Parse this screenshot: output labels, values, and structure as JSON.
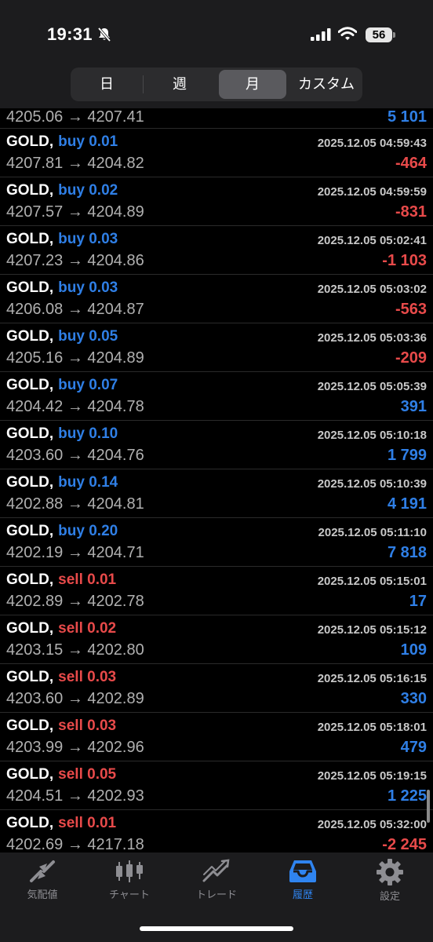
{
  "status_bar": {
    "time": "19:31",
    "battery": "56"
  },
  "period_tabs": [
    {
      "label": "日",
      "active": false
    },
    {
      "label": "週",
      "active": false
    },
    {
      "label": "月",
      "active": true
    },
    {
      "label": "カスタム",
      "active": false
    }
  ],
  "first_row": {
    "prices": "4205.06 → 4207.41",
    "profit": "5 101"
  },
  "deals": [
    {
      "symbol": "GOLD,",
      "side": "buy 0.01",
      "time": "2025.12.05 04:59:43",
      "prices": "4207.81 → 4204.82",
      "profit": "-464"
    },
    {
      "symbol": "GOLD,",
      "side": "buy 0.02",
      "time": "2025.12.05 04:59:59",
      "prices": "4207.57 → 4204.89",
      "profit": "-831"
    },
    {
      "symbol": "GOLD,",
      "side": "buy 0.03",
      "time": "2025.12.05 05:02:41",
      "prices": "4207.23 → 4204.86",
      "profit": "-1 103"
    },
    {
      "symbol": "GOLD,",
      "side": "buy 0.03",
      "time": "2025.12.05 05:03:02",
      "prices": "4206.08 → 4204.87",
      "profit": "-563"
    },
    {
      "symbol": "GOLD,",
      "side": "buy 0.05",
      "time": "2025.12.05 05:03:36",
      "prices": "4205.16 → 4204.89",
      "profit": "-209"
    },
    {
      "symbol": "GOLD,",
      "side": "buy 0.07",
      "time": "2025.12.05 05:05:39",
      "prices": "4204.42 → 4204.78",
      "profit": "391"
    },
    {
      "symbol": "GOLD,",
      "side": "buy 0.10",
      "time": "2025.12.05 05:10:18",
      "prices": "4203.60 → 4204.76",
      "profit": "1 799"
    },
    {
      "symbol": "GOLD,",
      "side": "buy 0.14",
      "time": "2025.12.05 05:10:39",
      "prices": "4202.88 → 4204.81",
      "profit": "4 191"
    },
    {
      "symbol": "GOLD,",
      "side": "buy 0.20",
      "time": "2025.12.05 05:11:10",
      "prices": "4202.19 → 4204.71",
      "profit": "7 818"
    },
    {
      "symbol": "GOLD,",
      "side": "sell 0.01",
      "time": "2025.12.05 05:15:01",
      "prices": "4202.89 → 4202.78",
      "profit": "17"
    },
    {
      "symbol": "GOLD,",
      "side": "sell 0.02",
      "time": "2025.12.05 05:15:12",
      "prices": "4203.15 → 4202.80",
      "profit": "109"
    },
    {
      "symbol": "GOLD,",
      "side": "sell 0.03",
      "time": "2025.12.05 05:16:15",
      "prices": "4203.60 → 4202.89",
      "profit": "330"
    },
    {
      "symbol": "GOLD,",
      "side": "sell 0.03",
      "time": "2025.12.05 05:18:01",
      "prices": "4203.99 → 4202.96",
      "profit": "479"
    },
    {
      "symbol": "GOLD,",
      "side": "sell 0.05",
      "time": "2025.12.05 05:19:15",
      "prices": "4204.51 → 4202.93",
      "profit": "1 225"
    },
    {
      "symbol": "GOLD,",
      "side": "sell 0.01",
      "time": "2025.12.05 05:32:00",
      "prices": "4202.69 → 4217.18",
      "profit": "-2 245"
    }
  ],
  "bottom_tabs": [
    {
      "label": "気配値",
      "icon": "quotes-icon",
      "active": false
    },
    {
      "label": "チャート",
      "icon": "chart-candles-icon",
      "active": false
    },
    {
      "label": "トレード",
      "icon": "trade-icon",
      "active": false
    },
    {
      "label": "履歴",
      "icon": "history-inbox-icon",
      "active": true
    },
    {
      "label": "設定",
      "icon": "gear-icon",
      "active": false
    }
  ],
  "colors": {
    "buy": "#2f7fe6",
    "sell": "#e84a4a",
    "profit_positive": "#2f7fe6",
    "profit_negative": "#e84a4a",
    "active_tab": "#2f84f0"
  }
}
